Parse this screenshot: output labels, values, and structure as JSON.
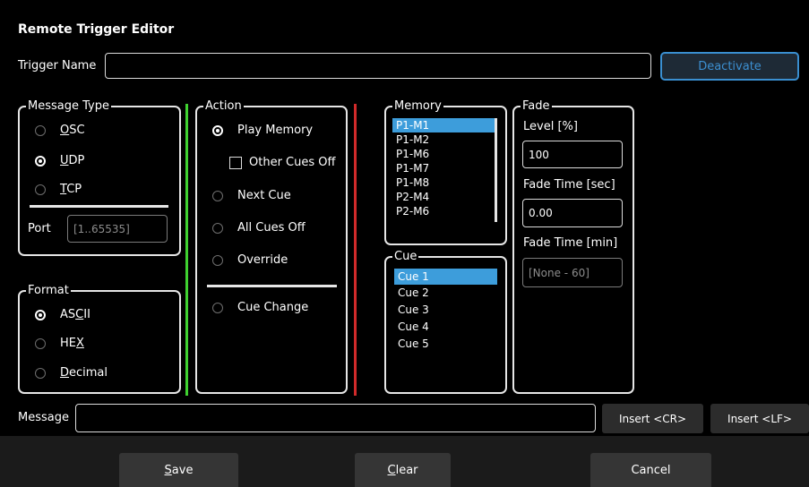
{
  "window": {
    "title": "Remote Trigger Editor"
  },
  "trigger": {
    "label": "Trigger Name",
    "value": "",
    "deactivate_label": "Deactivate"
  },
  "message_type": {
    "legend": "Message Type",
    "options": [
      {
        "pre": "",
        "ul": "O",
        "post": "SC",
        "selected": false
      },
      {
        "pre": "",
        "ul": "U",
        "post": "DP",
        "selected": true
      },
      {
        "pre": "",
        "ul": "T",
        "post": "CP",
        "selected": false
      }
    ],
    "port_label": "Port",
    "port_placeholder": "[1..65535]"
  },
  "format": {
    "legend": "Format",
    "options": [
      {
        "pre": "AS",
        "ul": "C",
        "post": "II",
        "selected": true
      },
      {
        "pre": "HE",
        "ul": "X",
        "post": "",
        "selected": false
      },
      {
        "pre": "",
        "ul": "D",
        "post": "ecimal",
        "selected": false
      }
    ]
  },
  "action": {
    "legend": "Action",
    "options": [
      {
        "label": "Play Memory",
        "selected": true
      },
      {
        "label": "Next Cue",
        "selected": false
      },
      {
        "label": "All Cues Off",
        "selected": false
      },
      {
        "label": "Override",
        "selected": false
      },
      {
        "label": "Cue Change",
        "selected": false
      }
    ],
    "other_cues_off_label": "Other Cues Off",
    "other_cues_off_checked": false
  },
  "memory": {
    "legend": "Memory",
    "items": [
      "P1-M1",
      "P1-M2",
      "P1-M6",
      "P1-M7",
      "P1-M8",
      "P2-M4",
      "P2-M6"
    ],
    "selected_index": 0
  },
  "cue": {
    "legend": "Cue",
    "items": [
      "Cue 1",
      "Cue 2",
      "Cue 3",
      "Cue 4",
      "Cue 5"
    ],
    "selected_index": 0
  },
  "fade": {
    "legend": "Fade",
    "level_label": "Level [%]",
    "level_value": "100",
    "time_sec_label": "Fade Time [sec]",
    "time_sec_value": "0.00",
    "time_min_label": "Fade Time [min]",
    "time_min_placeholder": "[None - 60]"
  },
  "message": {
    "label": "Message",
    "value": "",
    "insert_cr": "Insert <CR>",
    "insert_lf": "Insert <LF>"
  },
  "footer": {
    "save_ul": "S",
    "save_rest": "ave",
    "clear_ul": "C",
    "clear_rest": "lear",
    "cancel": "Cancel"
  },
  "colors": {
    "accent": "#3d9ddb",
    "green_divider": "#3fd130",
    "red_divider": "#d12a2a"
  }
}
